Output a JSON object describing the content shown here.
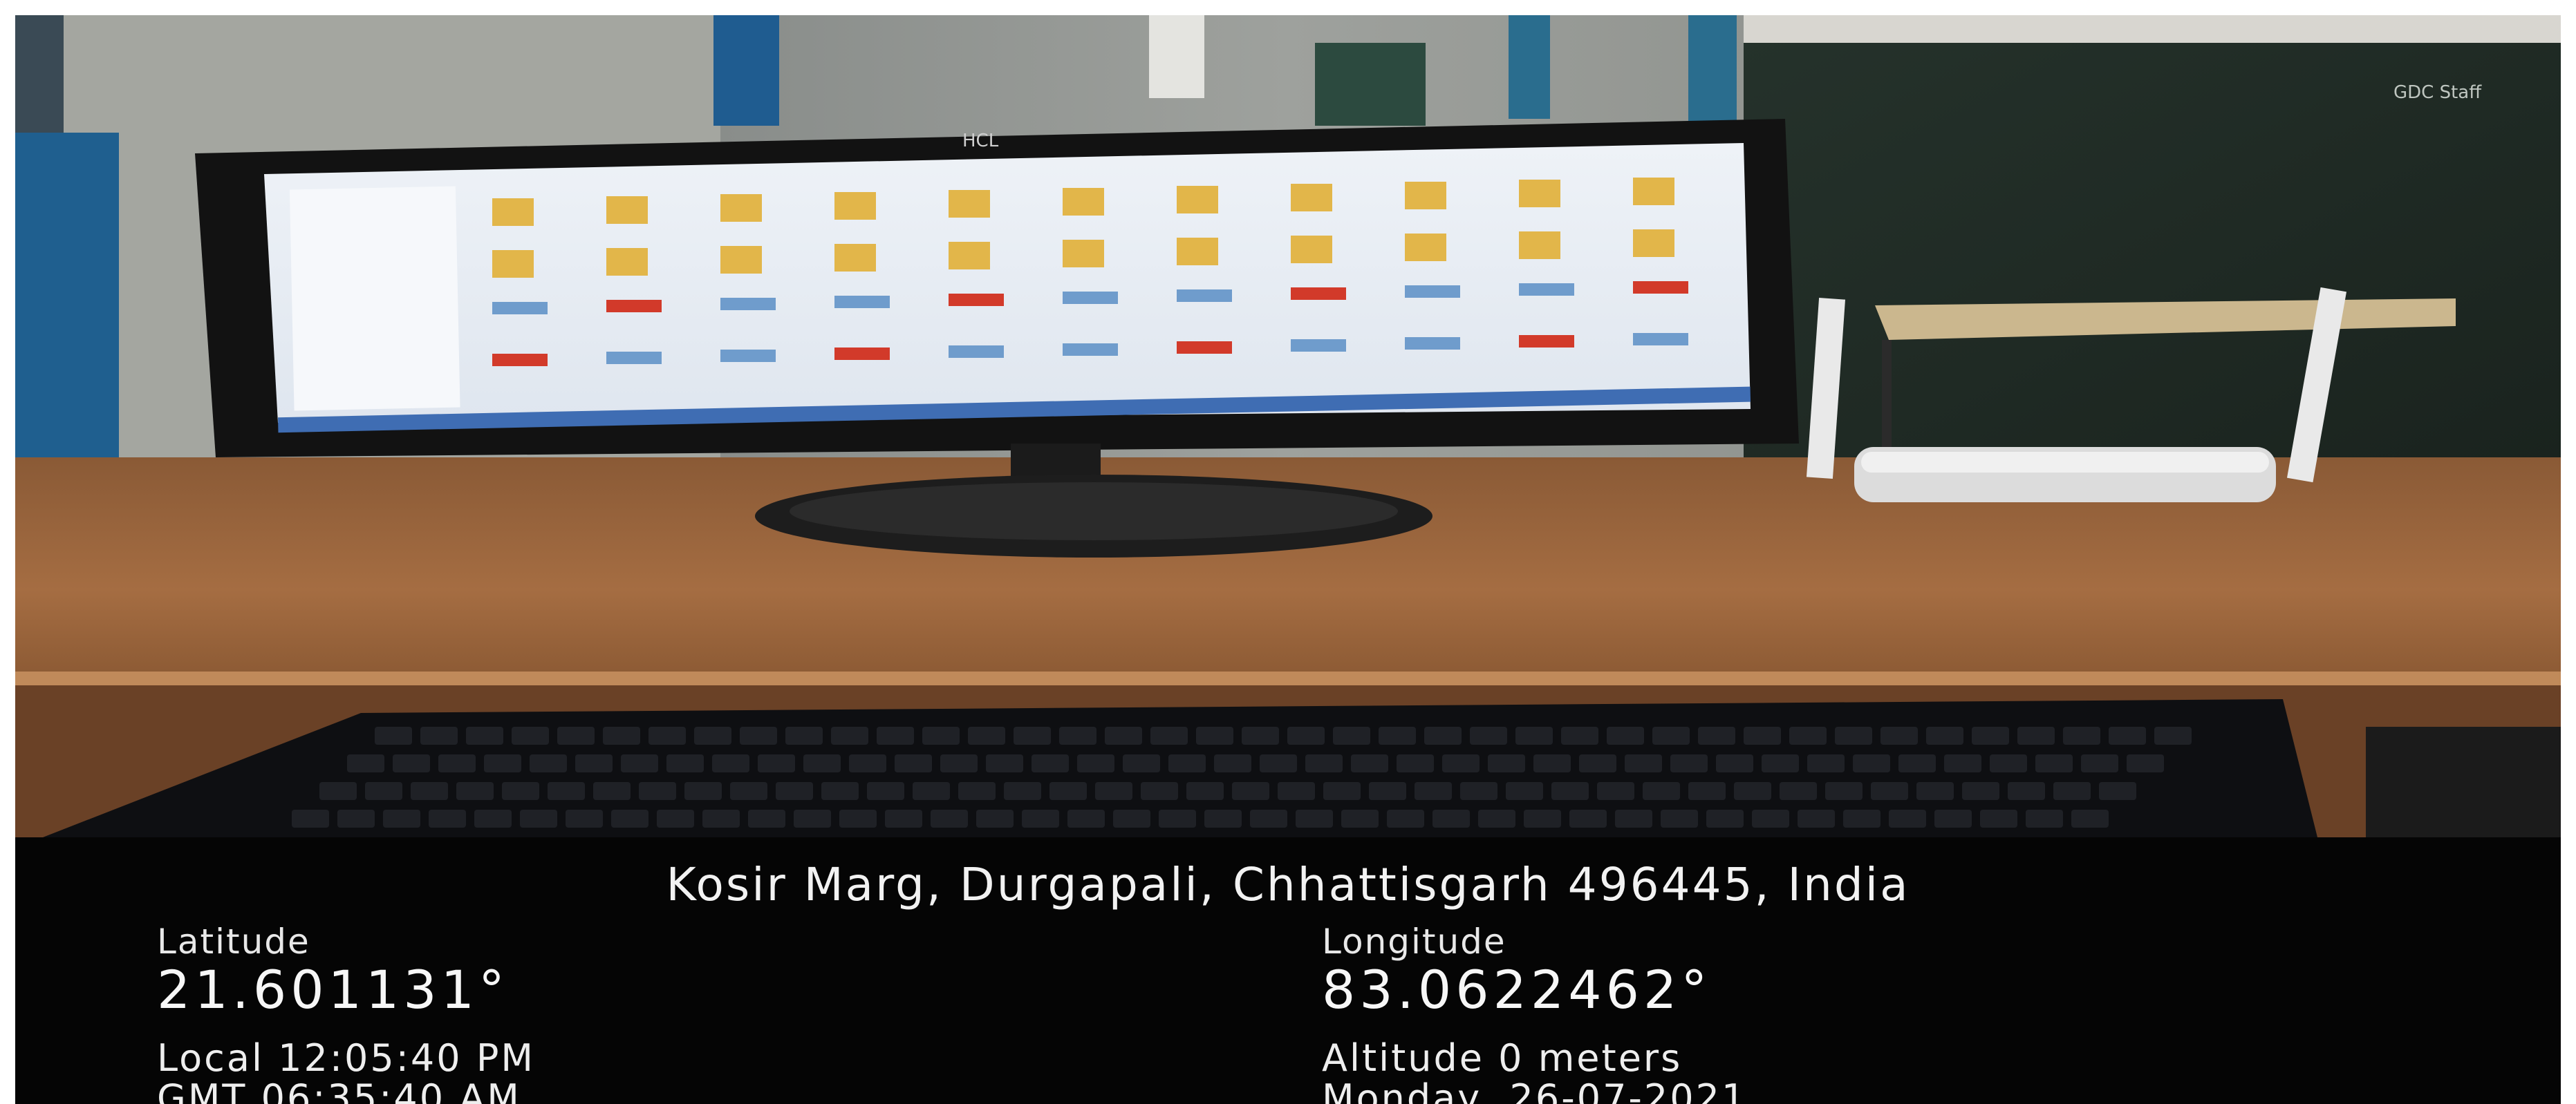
{
  "stamp": {
    "address": "Kosir Marg, Durgapali, Chhattisgarh 496445, India",
    "latitude_label": "Latitude",
    "latitude_value": "21.601131°",
    "longitude_label": "Longitude",
    "longitude_value": "83.0622462°",
    "local_time": "Local 12:05:40 PM",
    "gmt_time": "GMT 06:35:40 AM",
    "altitude": "Altitude 0 meters",
    "date": "Monday, 26-07-2021"
  },
  "photo": {
    "monitor_brand": "HCL",
    "wall_text": "GDC Staff"
  }
}
